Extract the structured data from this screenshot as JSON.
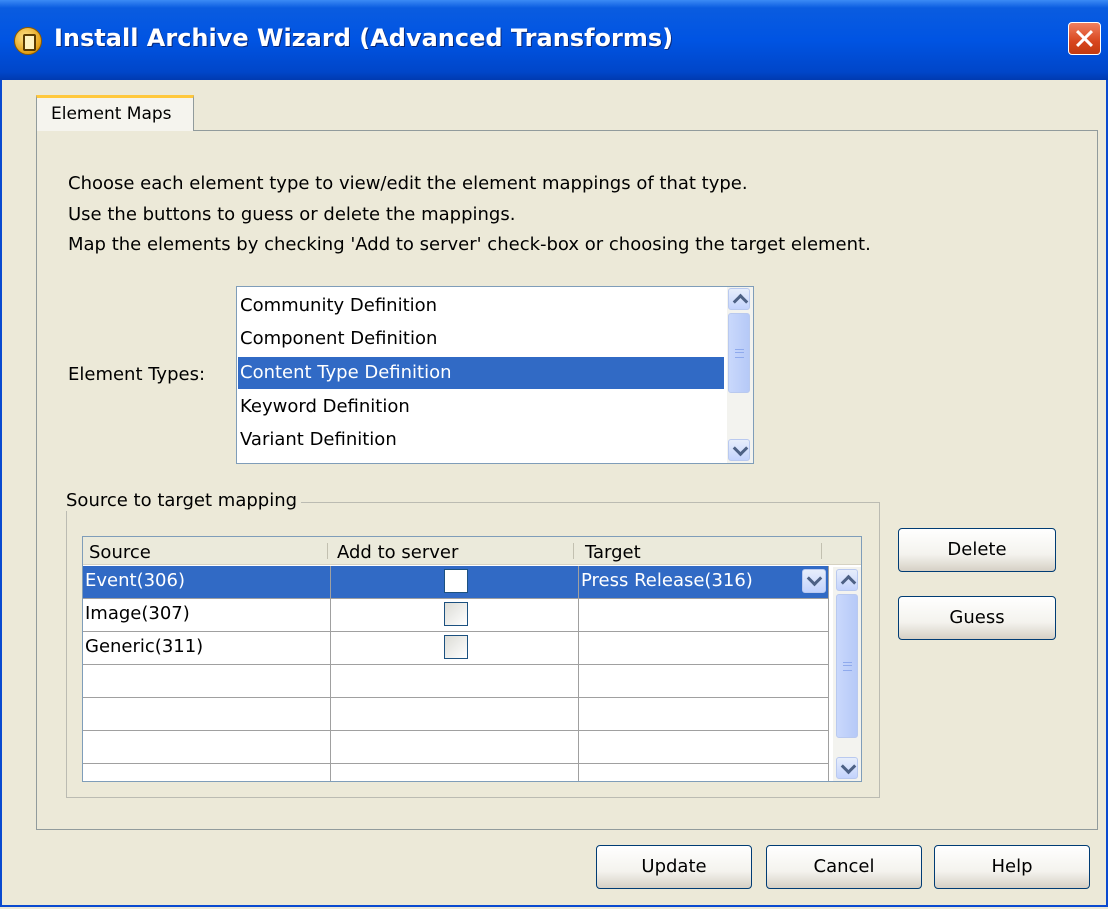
{
  "window": {
    "title": "Install Archive Wizard (Advanced Transforms)"
  },
  "tabs": [
    {
      "label": "Element Maps"
    }
  ],
  "instructions": [
    "Choose each element type to view/edit the element mappings of that type.",
    "Use the buttons to guess or delete the mappings.",
    "Map the elements by checking 'Add to server' check-box or choosing the target element."
  ],
  "element_types": {
    "label": "Element Types:",
    "items": [
      {
        "label": "Community Definition",
        "selected": false
      },
      {
        "label": "Component Definition",
        "selected": false
      },
      {
        "label": "Content Type Definition",
        "selected": true
      },
      {
        "label": "Keyword Definition",
        "selected": false
      },
      {
        "label": "Variant Definition",
        "selected": false
      }
    ]
  },
  "mapping": {
    "group_label": "Source to target mapping",
    "columns": [
      "Source",
      "Add to server",
      "Target"
    ],
    "rows": [
      {
        "source": "Event(306)",
        "add_to_server": false,
        "target": "Press Release(316)",
        "selected": true
      },
      {
        "source": "Image(307)",
        "add_to_server": false,
        "target": "",
        "selected": false
      },
      {
        "source": "Generic(311)",
        "add_to_server": false,
        "target": "",
        "selected": false
      },
      {
        "source": "",
        "target": ""
      },
      {
        "source": "",
        "target": ""
      },
      {
        "source": "",
        "target": ""
      },
      {
        "source": "",
        "target": ""
      }
    ]
  },
  "side_buttons": {
    "delete_label": "Delete",
    "guess_label": "Guess"
  },
  "footer_buttons": {
    "update_label": "Update",
    "cancel_label": "Cancel",
    "help_label": "Help"
  },
  "colors": {
    "selection": "#316ac5",
    "titlebar": "#0054e3",
    "dialog_bg": "#ece9d8",
    "close_button": "#d8461e"
  }
}
